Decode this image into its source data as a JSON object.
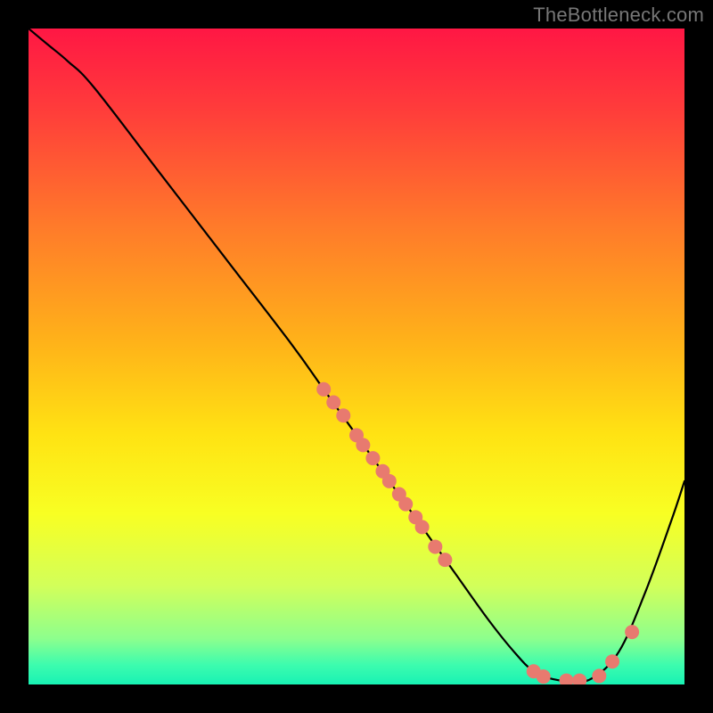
{
  "watermark": "TheBottleneck.com",
  "chart_data": {
    "type": "line",
    "title": "",
    "xlabel": "",
    "ylabel": "",
    "xlim": [
      0,
      100
    ],
    "ylim": [
      0,
      100
    ],
    "background_gradient": {
      "direction": "vertical",
      "stops": [
        {
          "offset": 0.0,
          "color": "#ff1744"
        },
        {
          "offset": 0.12,
          "color": "#ff3b3b"
        },
        {
          "offset": 0.3,
          "color": "#ff7a2a"
        },
        {
          "offset": 0.48,
          "color": "#ffb319"
        },
        {
          "offset": 0.62,
          "color": "#ffe313"
        },
        {
          "offset": 0.74,
          "color": "#f8ff23"
        },
        {
          "offset": 0.85,
          "color": "#d2ff5a"
        },
        {
          "offset": 0.93,
          "color": "#8dff8d"
        },
        {
          "offset": 0.97,
          "color": "#3dfcae"
        },
        {
          "offset": 1.0,
          "color": "#18f2b4"
        }
      ]
    },
    "series": [
      {
        "name": "curve",
        "type": "line",
        "color": "#000000",
        "width": 2.2,
        "points": [
          {
            "x": 0,
            "y": 100
          },
          {
            "x": 3,
            "y": 97.5
          },
          {
            "x": 6,
            "y": 95
          },
          {
            "x": 10,
            "y": 91
          },
          {
            "x": 20,
            "y": 78
          },
          {
            "x": 30,
            "y": 65
          },
          {
            "x": 40,
            "y": 52
          },
          {
            "x": 45,
            "y": 45
          },
          {
            "x": 50,
            "y": 38
          },
          {
            "x": 55,
            "y": 31
          },
          {
            "x": 60,
            "y": 24
          },
          {
            "x": 65,
            "y": 17
          },
          {
            "x": 70,
            "y": 10
          },
          {
            "x": 74,
            "y": 5
          },
          {
            "x": 77,
            "y": 2
          },
          {
            "x": 80,
            "y": 0.8
          },
          {
            "x": 83,
            "y": 0.5
          },
          {
            "x": 86,
            "y": 1
          },
          {
            "x": 90,
            "y": 5
          },
          {
            "x": 94,
            "y": 14
          },
          {
            "x": 98,
            "y": 25
          },
          {
            "x": 100,
            "y": 31
          }
        ]
      },
      {
        "name": "markers",
        "type": "scatter",
        "color": "#e87a6f",
        "radius": 8,
        "points": [
          {
            "x": 45,
            "y": 45
          },
          {
            "x": 46.5,
            "y": 43
          },
          {
            "x": 48,
            "y": 41
          },
          {
            "x": 50,
            "y": 38
          },
          {
            "x": 51,
            "y": 36.5
          },
          {
            "x": 52.5,
            "y": 34.5
          },
          {
            "x": 54,
            "y": 32.5
          },
          {
            "x": 55,
            "y": 31
          },
          {
            "x": 56.5,
            "y": 29
          },
          {
            "x": 57.5,
            "y": 27.5
          },
          {
            "x": 59,
            "y": 25.5
          },
          {
            "x": 60,
            "y": 24
          },
          {
            "x": 62,
            "y": 21
          },
          {
            "x": 63.5,
            "y": 19
          },
          {
            "x": 77,
            "y": 2
          },
          {
            "x": 78.5,
            "y": 1.2
          },
          {
            "x": 82,
            "y": 0.6
          },
          {
            "x": 84,
            "y": 0.6
          },
          {
            "x": 87,
            "y": 1.3
          },
          {
            "x": 89,
            "y": 3.5
          },
          {
            "x": 92,
            "y": 8
          }
        ]
      }
    ]
  }
}
